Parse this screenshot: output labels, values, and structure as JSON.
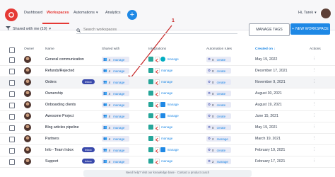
{
  "nav": {
    "dashboard": "Dashboard",
    "workspaces": "Workspaces",
    "automations": "Automations",
    "analytics": "Analytics",
    "plus": "+",
    "greeting": "Hi, Tarek"
  },
  "toolbar": {
    "filter_label": "Shared with me (10)",
    "search_placeholder": "Search workspaces",
    "manage_tags": "MANAGE TAGS",
    "new_workspace": "NEW WORKSPACE"
  },
  "table": {
    "headers": {
      "owner": "Owner",
      "name": "Name",
      "shared": "Shared with",
      "integrations": "Integrations",
      "automation": "Automation rules",
      "created": "Created on",
      "actions": "Actions"
    },
    "manage_label": "manage",
    "create_label": "create",
    "rows": [
      {
        "name": "General communication",
        "badge": "",
        "shared": "4",
        "integrations": [
          "green",
          "gmail",
          "cyan"
        ],
        "rules": "0",
        "rule_action": "create",
        "date": "May 19, 2022"
      },
      {
        "name": "Refunds/Rejected",
        "badge": "",
        "shared": "4",
        "integrations": [
          "green",
          "gmail"
        ],
        "rules": "0",
        "rule_action": "create",
        "date": "December 17, 2021"
      },
      {
        "name": "Orders",
        "badge": "Inbox",
        "shared": "4",
        "integrations": [
          "green",
          "gmail"
        ],
        "rules": "0",
        "rule_action": "create",
        "date": "November 9, 2021"
      },
      {
        "name": "Ownership",
        "badge": "",
        "shared": "4",
        "integrations": [
          "green",
          "gmail"
        ],
        "rules": "0",
        "rule_action": "create",
        "date": "August 30, 2021"
      },
      {
        "name": "Onboarding clients",
        "badge": "",
        "shared": "4",
        "integrations": [
          "green",
          "gmail",
          "blue"
        ],
        "rules": "0",
        "rule_action": "create",
        "date": "August 19, 2021"
      },
      {
        "name": "Awesome Project",
        "badge": "",
        "shared": "4",
        "integrations": [
          "green",
          "gmail",
          "blue"
        ],
        "rules": "0",
        "rule_action": "create",
        "date": "June 15, 2021"
      },
      {
        "name": "Blog articles pipeline",
        "badge": "",
        "shared": "4",
        "integrations": [
          "green",
          "gmail"
        ],
        "rules": "0",
        "rule_action": "create",
        "date": "May 19, 2021"
      },
      {
        "name": "Partners",
        "badge": "",
        "shared": "4",
        "integrations": [
          "green",
          "gmail"
        ],
        "rules": "2",
        "rule_action": "manage",
        "date": "March 19, 2021"
      },
      {
        "name": "Info - Team Inbox",
        "badge": "Inbox",
        "shared": "4",
        "integrations": [
          "green",
          "gmail",
          "blue"
        ],
        "rules": "0",
        "rule_action": "create",
        "date": "February 19, 2021"
      },
      {
        "name": "Support",
        "badge": "Inbox",
        "shared": "4",
        "integrations": [
          "green",
          "gmail"
        ],
        "rules": "2",
        "rule_action": "manage",
        "date": "February 17, 2021"
      }
    ]
  },
  "annotation": "1",
  "footer": {
    "text": "Need help? Visit our knowledge base · Contact a product coach"
  }
}
